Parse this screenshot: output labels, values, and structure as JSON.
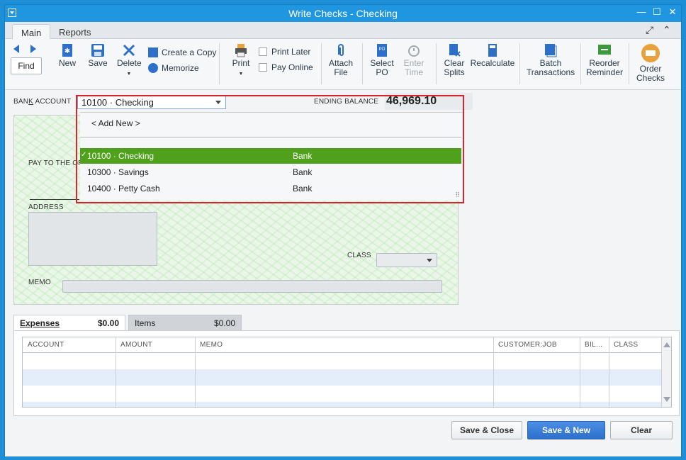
{
  "window": {
    "title": "Write Checks - Checking"
  },
  "tabs": [
    {
      "label": "Main"
    },
    {
      "label": "Reports"
    }
  ],
  "toolbar": {
    "find": "Find",
    "new": "New",
    "save": "Save",
    "delete": "Delete",
    "create_copy": "Create a Copy",
    "memorize": "Memorize",
    "print": "Print",
    "print_later": "Print Later",
    "pay_online": "Pay Online",
    "attach_file_1": "Attach",
    "attach_file_2": "File",
    "select_po_1": "Select",
    "select_po_2": "PO",
    "enter_time_1": "Enter",
    "enter_time_2": "Time",
    "clear_splits_1": "Clear",
    "clear_splits_2": "Splits",
    "recalculate": "Recalculate",
    "batch_1": "Batch",
    "batch_2": "Transactions",
    "reorder_1": "Reorder",
    "reorder_2": "Reminder",
    "order_checks_1": "Order",
    "order_checks_2": "Checks"
  },
  "form": {
    "bank_account_label_pre": "BAN",
    "bank_account_label_k": "K",
    "bank_account_label_post": " ACCOUNT",
    "bank_account_value": "10100 · Checking",
    "ending_balance_label": "ENDING BALANCE",
    "ending_balance_value": "46,969.10",
    "pay_to_label": "PAY TO THE OR",
    "address_label": "ADDRESS",
    "class_label": "CLASS",
    "memo_label": "MEMO"
  },
  "dropdown": {
    "add_new": "< Add New >",
    "items": [
      {
        "name": "10100 · Checking",
        "type": "Bank",
        "selected": true
      },
      {
        "name": "10300 · Savings",
        "type": "Bank"
      },
      {
        "name": "10400 · Petty Cash",
        "type": "Bank"
      }
    ]
  },
  "lower_tabs": {
    "expenses_label": "Expenses",
    "expenses_amount": "$0.00",
    "items_label": "Items",
    "items_amount": "$0.00"
  },
  "grid": {
    "columns": [
      "ACCOUNT",
      "AMOUNT",
      "MEMO",
      "CUSTOMER:JOB",
      "BIL...",
      "CLASS"
    ]
  },
  "buttons": {
    "save_close": "Save & Close",
    "save_new": "Save & New",
    "clear": "Clear"
  },
  "colors": {
    "titlebar": "#2196e0",
    "selection": "#4fa01b",
    "highlight_border": "#d9262c",
    "primary_button": "#2d6fc9"
  }
}
